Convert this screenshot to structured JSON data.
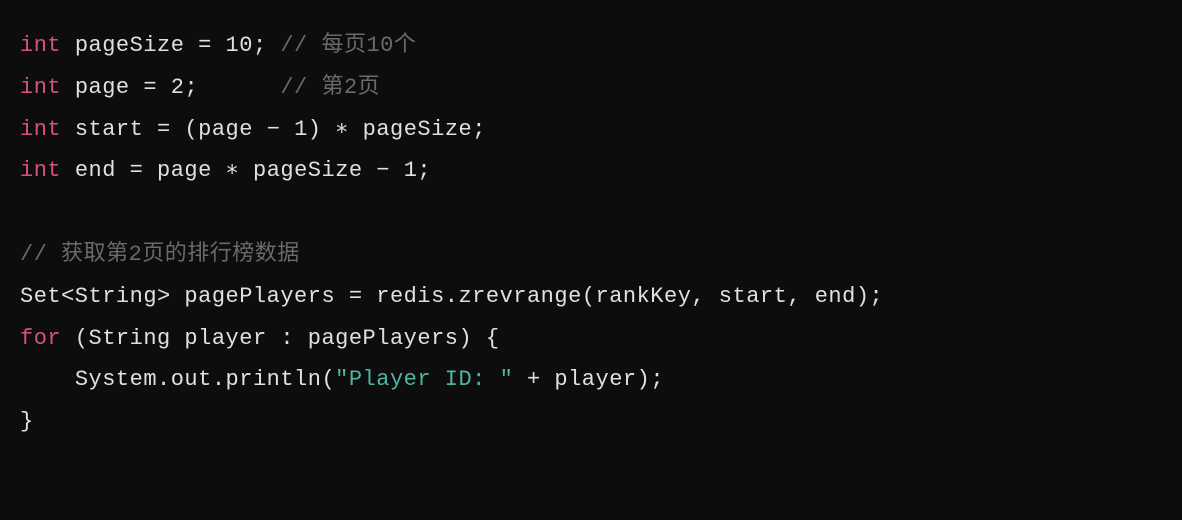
{
  "code": {
    "line1": {
      "kw_int": "int",
      "var": "pageSize",
      "eq": " = ",
      "val": "10",
      "semi": "; ",
      "comment": "// 每页10个"
    },
    "line2": {
      "kw_int": "int",
      "var": "page",
      "eq": " = ",
      "val": "2",
      "semi": ";      ",
      "comment": "// 第2页"
    },
    "line3": {
      "kw_int": "int",
      "var": "start",
      "eq": " = (page − ",
      "one": "1",
      "rest": ") ∗ pageSize;"
    },
    "line4": {
      "kw_int": "int",
      "var": "end",
      "eq": " = page ∗ pageSize − ",
      "one": "1",
      "semi": ";"
    },
    "line5": {
      "comment": "// 获取第2页的排行榜数据"
    },
    "line6": {
      "text": "Set<String> pagePlayers = redis.zrevrange(rankKey, start, end);"
    },
    "line7": {
      "for_kw": "for",
      "rest": " (String player : pagePlayers) {"
    },
    "line8": {
      "indent": "    ",
      "pre": "System.out.println(",
      "str": "\"Player ID: \"",
      "post": " + player);"
    },
    "line9": {
      "text": "}"
    }
  }
}
